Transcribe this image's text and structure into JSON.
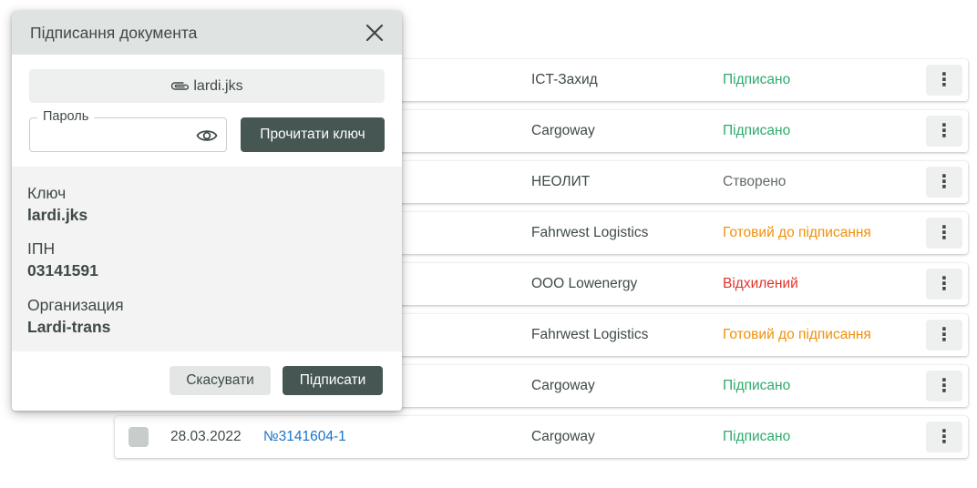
{
  "table": {
    "rows": [
      {
        "company": "ICT-Захид",
        "status": "Підписано",
        "status_type": "signed"
      },
      {
        "company": "Cargoway",
        "status": "Підписано",
        "status_type": "signed"
      },
      {
        "company": "НЕОЛИТ",
        "status": "Створено",
        "status_type": "created"
      },
      {
        "company": "Fahrwest Logistics",
        "status": "Готовий до підписання",
        "status_type": "ready"
      },
      {
        "company": "ООО Lowenergy",
        "status": "Відхилений",
        "status_type": "rejected"
      },
      {
        "company": "Fahrwest Logistics",
        "status": "Готовий до підписання",
        "status_type": "ready"
      },
      {
        "company": "Cargoway",
        "status": "Підписано",
        "status_type": "signed"
      },
      {
        "date": "28.03.2022",
        "number": "№3141604-1",
        "company": "Cargoway",
        "status": "Підписано",
        "status_type": "signed"
      }
    ],
    "menu_glyph": "⋮"
  },
  "modal": {
    "title": "Підписання документа",
    "file_name": "lardi.jks",
    "password": {
      "label": "Пароль",
      "value": ""
    },
    "read_key_label": "Прочитати ключ",
    "key_info": {
      "key_label": "Ключ",
      "key_value": "lardi.jks",
      "ipn_label": "ІПН",
      "ipn_value": "03141591",
      "org_label": "Организация",
      "org_value": "Lardi-trans"
    },
    "cancel_label": "Скасувати",
    "sign_label": "Підписати"
  },
  "colors": {
    "primary_button": "#465753",
    "status_signed": "#2eaa6c",
    "status_created": "#606a68",
    "status_ready": "#f0900c",
    "status_rejected": "#e0322c",
    "link": "#1a73c8"
  },
  "icons": {
    "close": "close-icon",
    "attachment": "paperclip-icon",
    "visibility": "eye-icon",
    "row_menu": "more-vertical-icon"
  }
}
